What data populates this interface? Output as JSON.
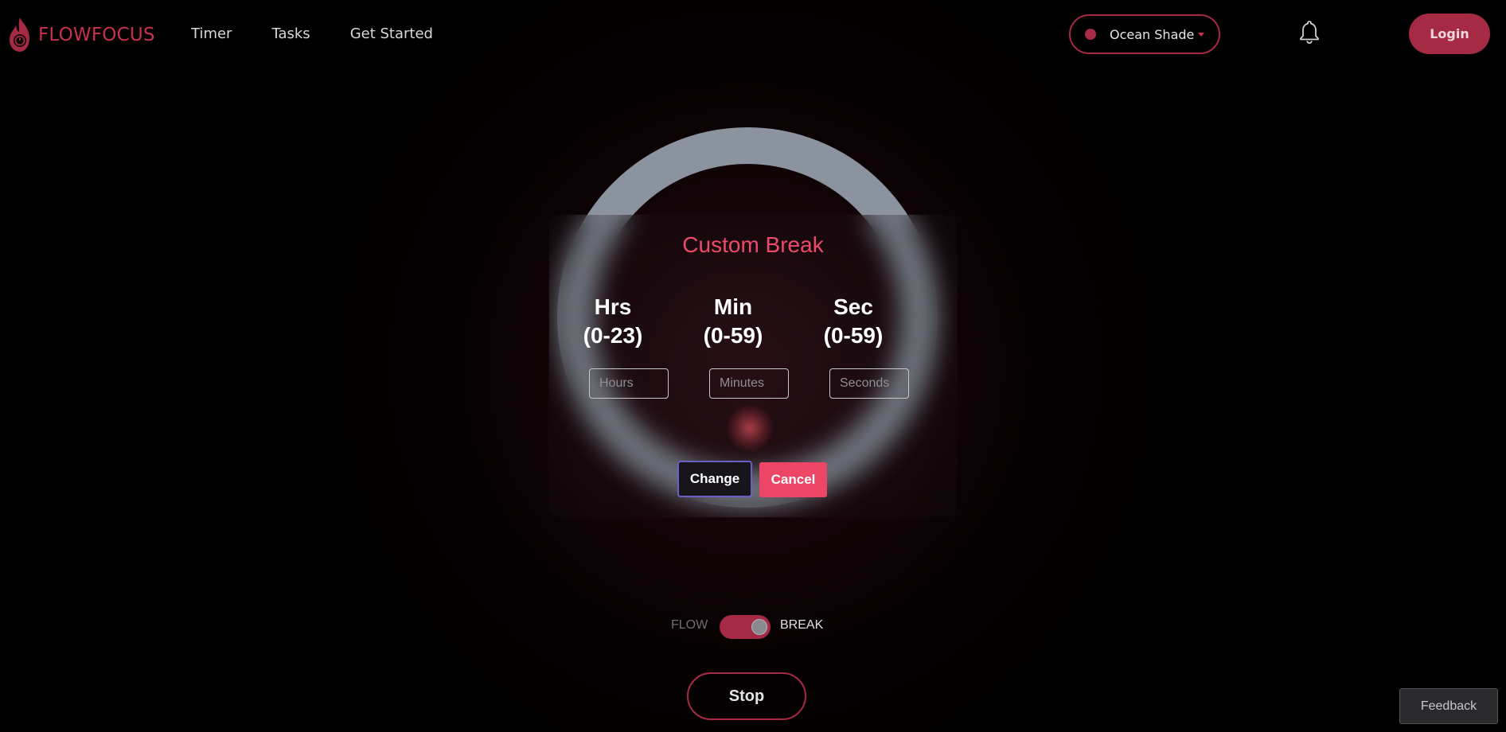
{
  "header": {
    "brand": "FLOWFOCUS",
    "nav": [
      {
        "label": "Timer"
      },
      {
        "label": "Tasks"
      },
      {
        "label": "Get Started"
      }
    ],
    "theme_selector": {
      "selected": "Ocean Shade",
      "dot_color": "#a82a45"
    },
    "notification_icon": "bell-icon",
    "login_label": "Login"
  },
  "modal": {
    "title": "Custom Break",
    "fields": [
      {
        "label_line1": "Hrs",
        "label_line2": "(0-23)",
        "placeholder": "Hours"
      },
      {
        "label_line1": "Min",
        "label_line2": "(0-59)",
        "placeholder": "Minutes"
      },
      {
        "label_line1": "Sec",
        "label_line2": "(0-59)",
        "placeholder": "Seconds"
      }
    ],
    "change_label": "Change",
    "cancel_label": "Cancel"
  },
  "mode_toggle": {
    "left_label": "FLOW",
    "right_label": "BREAK",
    "active": "BREAK"
  },
  "stop_label": "Stop",
  "feedback_label": "Feedback",
  "colors": {
    "accent": "#a52a43",
    "title_red": "#ee4a6c",
    "cancel_red": "#ec4566",
    "ring_gray": "#8a939e"
  }
}
